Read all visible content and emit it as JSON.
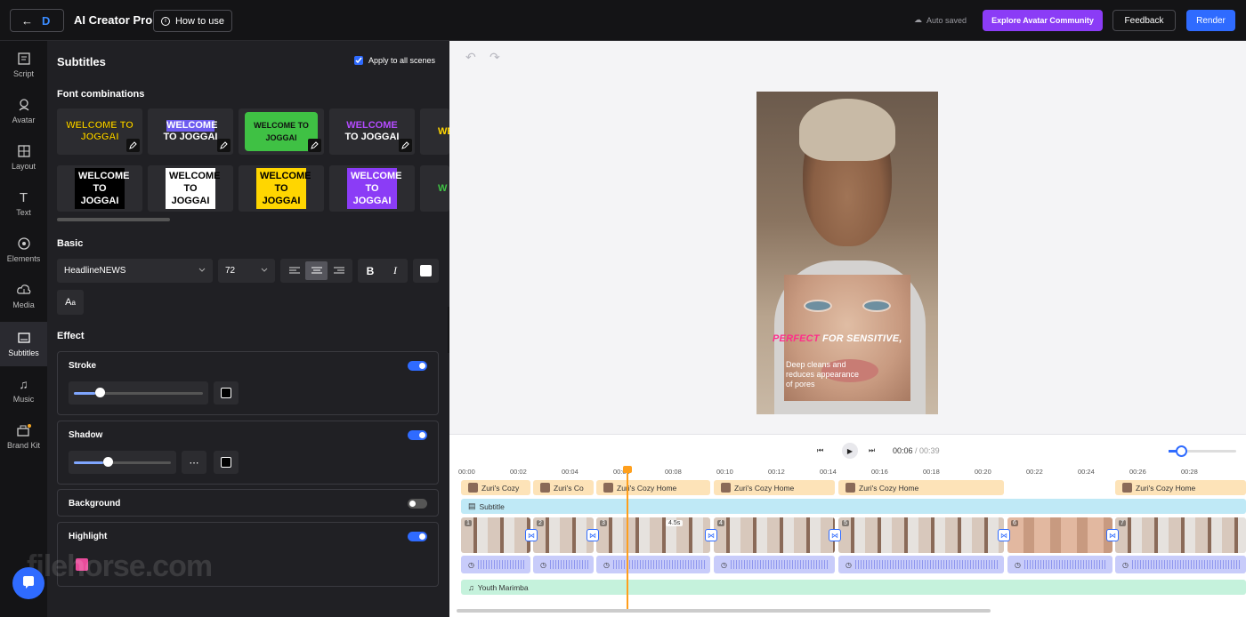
{
  "topbar": {
    "app_name": "AI Creator Pro",
    "how_to_use": "How to use",
    "auto_saved": "Auto saved",
    "explore": "Explore Avatar Community",
    "feedback": "Feedback",
    "render": "Render"
  },
  "nav": [
    {
      "label": "Script",
      "icon": "script-icon"
    },
    {
      "label": "Avatar",
      "icon": "avatar-icon"
    },
    {
      "label": "Layout",
      "icon": "layout-icon"
    },
    {
      "label": "Text",
      "icon": "text-icon"
    },
    {
      "label": "Elements",
      "icon": "elements-icon"
    },
    {
      "label": "Media",
      "icon": "media-icon"
    },
    {
      "label": "Subtitles",
      "icon": "subtitles-icon"
    },
    {
      "label": "Music",
      "icon": "music-icon"
    },
    {
      "label": "Brand Kit",
      "icon": "brand-kit-icon"
    }
  ],
  "panel": {
    "title": "Subtitles",
    "apply_all": "Apply to all scenes",
    "font_combinations": "Font combinations",
    "fc_row1": [
      "WELCOME TO JOGGAI",
      "WELCOME TO JOGGAI",
      "WELCOME TO JOGGAI",
      "WELCOME TO JOGGAI",
      "WE"
    ],
    "fc_row2": [
      "WELCOME TO JOGGAI",
      "WELCOME TO JOGGAI",
      "WELCOME TO JOGGAI",
      "WELCOME TO JOGGAI",
      "W"
    ],
    "basic": "Basic",
    "font": "HeadlineNEWS",
    "size": "72",
    "effect": "Effect",
    "stroke": "Stroke",
    "shadow": "Shadow",
    "background": "Background",
    "highlight": "Highlight",
    "stroke_level": 0.17,
    "shadow_level": 0.3,
    "toggles": {
      "stroke": true,
      "shadow": true,
      "background": false,
      "highlight": true
    },
    "highlight_color": "#e84c9b"
  },
  "preview": {
    "caption_pink": "PERFECT",
    "caption_white": " FOR SENSITIVE,",
    "subtext": "Deep cleans and reduces appearance of pores"
  },
  "transport": {
    "current": "00:06",
    "total": "/ 00:39"
  },
  "timeline": {
    "ticks": [
      "00:00",
      "00:02",
      "00:04",
      "00:06",
      "00:08",
      "00:10",
      "00:12",
      "00:14",
      "00:16",
      "00:18",
      "00:20",
      "00:22",
      "00:24",
      "00:26",
      "00:28"
    ],
    "scenes": [
      "Zuri's Cozy",
      "Zuri's Co",
      "Zuri's Cozy Home",
      "Zuri's Cozy Home",
      "Zuri's Cozy Home",
      "Zuri's Cozy Home"
    ],
    "subtitle_track": "Subtitle",
    "clip_numbers": [
      "1",
      "2",
      "3",
      "4",
      "5",
      "6",
      "7"
    ],
    "clip_duration": "4.5s",
    "music_track": "Youth Marimba"
  },
  "watermark": "filehorse.com"
}
